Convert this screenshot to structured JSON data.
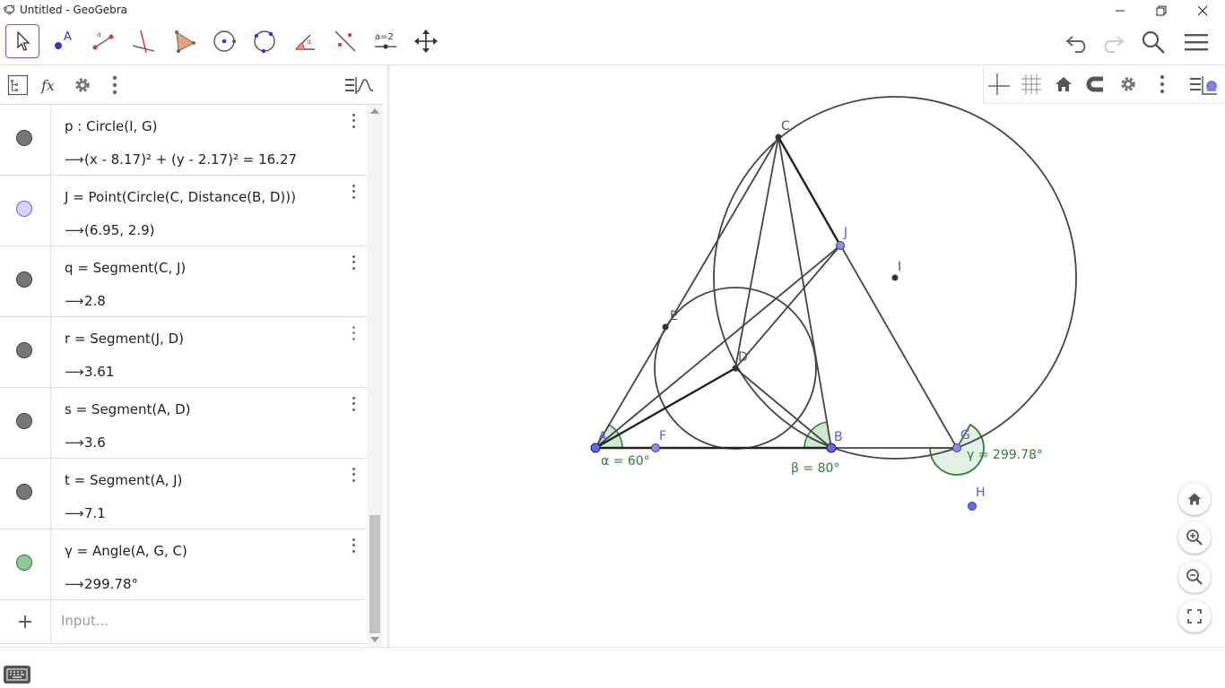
{
  "window": {
    "title": "Untitled - GeoGebra"
  },
  "toolbar": {
    "tools": [
      "move-tool",
      "point-tool",
      "line-tool",
      "perpendicular-tool",
      "polygon-tool",
      "circle-center-point-tool",
      "circle-three-points-tool",
      "angle-tool",
      "reflect-tool",
      "slider-tool",
      "move-graphics-tool"
    ],
    "slider_label": "a=2"
  },
  "algebra": {
    "rows": [
      {
        "def": "p : Circle(I, G)",
        "val": "(x - 8.17)² + (y - 2.17)² = 16.27",
        "color": "#777777",
        "more_color": "gray"
      },
      {
        "def": "J = Point(Circle(C, Distance(B, D)))",
        "val": "(6.95, 2.9)",
        "color": "#d6d2fb",
        "more_color": "gray"
      },
      {
        "def": "q = Segment(C, J)",
        "val": "2.8",
        "color": "#777777",
        "more_color": "gray"
      },
      {
        "def": "r = Segment(J, D)",
        "val": "3.61",
        "color": "#777777",
        "more_color": "purple"
      },
      {
        "def": "s = Segment(A, D)",
        "val": "3.6",
        "color": "#777777",
        "more_color": "gray"
      },
      {
        "def": "t = Segment(A, J)",
        "val": "7.1",
        "color": "#777777",
        "more_color": "gray"
      },
      {
        "def": "γ = Angle(A, G, C)",
        "val": "299.78°",
        "color": "#8fc896",
        "more_color": "gray"
      }
    ],
    "input_placeholder": "Input..."
  },
  "graphics": {
    "points": {
      "A": "A",
      "B": "B",
      "C": "C",
      "D": "D",
      "E": "E",
      "F": "F",
      "G": "G",
      "H": "H",
      "I": "I",
      "J": "J"
    },
    "angles": {
      "alpha": "α = 60°",
      "beta": "β = 80°",
      "gamma": "γ = 299.78°"
    }
  },
  "colors": {
    "accent": "#6557d2",
    "point_blue": "#6666ff",
    "angle_green": "#2e7d32",
    "line": "#444444"
  }
}
